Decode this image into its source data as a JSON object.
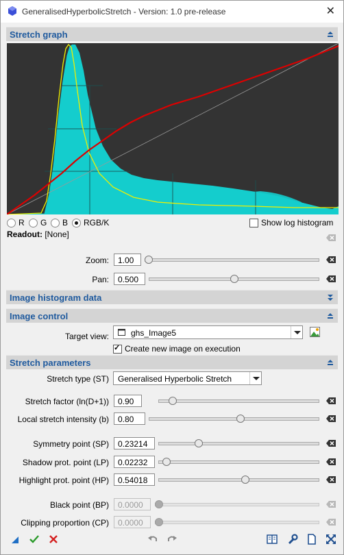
{
  "window": {
    "title": "GeneralisedHyperbolicStretch - Version: 1.0 pre-release",
    "close_label": "✕"
  },
  "sections": {
    "stretch_graph": "Stretch graph",
    "histogram_data": "Image histogram data",
    "image_control": "Image control",
    "stretch_params": "Stretch parameters"
  },
  "channels": {
    "r": "R",
    "g": "G",
    "b": "B",
    "rgbk": "RGB/K",
    "selected": "RGB/K"
  },
  "show_log": {
    "label": "Show log histogram",
    "checked": false
  },
  "readout": {
    "label": "Readout:",
    "value": "[None]"
  },
  "zoom": {
    "label": "Zoom:",
    "value": "1.00",
    "slider": 0.0
  },
  "pan": {
    "label": "Pan:",
    "value": "0.500",
    "slider": 0.5
  },
  "target_view": {
    "label": "Target view:",
    "value": "ghs_Image5"
  },
  "create_new": {
    "label": "Create new image on execution",
    "checked": true
  },
  "stretch_type": {
    "label": "Stretch type (ST)",
    "value": "Generalised Hyperbolic Stretch"
  },
  "params": {
    "stretch_factor": {
      "label": "Stretch factor (ln(D+1))",
      "value": "0.90",
      "slider": 0.09
    },
    "local_intensity": {
      "label": "Local stretch intensity (b)",
      "value": "0.80",
      "slider": 0.54
    },
    "symmetry": {
      "label": "Symmetry point (SP)",
      "value": "0.23214",
      "slider": 0.23
    },
    "shadow": {
      "label": "Shadow prot. point (LP)",
      "value": "0.02232",
      "slider": 0.02
    },
    "highlight": {
      "label": "Highlight prot. point (HP)",
      "value": "0.54018",
      "slider": 0.54
    },
    "black": {
      "label": "Black point (BP)",
      "value": "0.0000",
      "slider": 0.0
    },
    "clipping": {
      "label": "Clipping proportion (CP)",
      "value": "0.0000",
      "slider": 0.0
    }
  },
  "colors": {
    "section_text": "#1f5a9e",
    "histogram": "#14cdcd",
    "transform": "#dd0000",
    "derivative": "#f0f000",
    "graph_bg": "#333333"
  }
}
